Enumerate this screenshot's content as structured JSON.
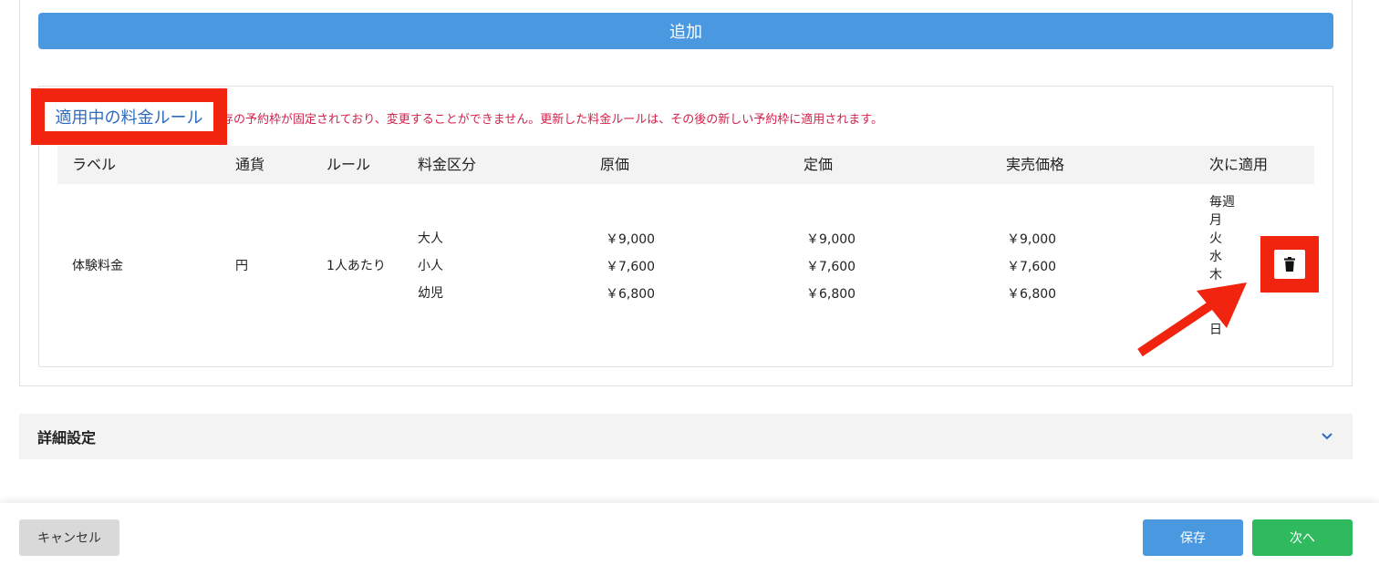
{
  "add_button_label": "追加",
  "rules_section": {
    "title": "適用中の料金ルール",
    "notice": "存の予約枠が固定されており、変更することができません。更新した料金ルールは、その後の新しい予約枠に適用されます。",
    "columns": [
      "ラベル",
      "通貨",
      "ルール",
      "料金区分",
      "原価",
      "定価",
      "実売価格",
      "次に適用"
    ],
    "row": {
      "label": "体験料金",
      "currency": "円",
      "rule": "1人あたり",
      "categories": [
        "大人",
        "小人",
        "幼児"
      ],
      "cost": [
        "￥9,000",
        "￥7,600",
        "￥6,800"
      ],
      "list_price": [
        "￥9,000",
        "￥7,600",
        "￥6,800"
      ],
      "sale_price": [
        "￥9,000",
        "￥7,600",
        "￥6,800"
      ],
      "apply_days": [
        "毎週",
        "月",
        "火",
        "水",
        "木",
        "",
        "",
        "日"
      ]
    },
    "delete_icon": "trash-icon",
    "highlight_color": "#f1240f"
  },
  "detail_settings": {
    "label": "詳細設定",
    "icon": "chevron-down-icon"
  },
  "footer": {
    "cancel_label": "キャンセル",
    "save_label": "保存",
    "next_label": "次へ"
  },
  "colors": {
    "primary": "#4a98e0",
    "success": "#2fba5e",
    "danger_text": "#d0224a",
    "title_link": "#2c6cc0"
  }
}
